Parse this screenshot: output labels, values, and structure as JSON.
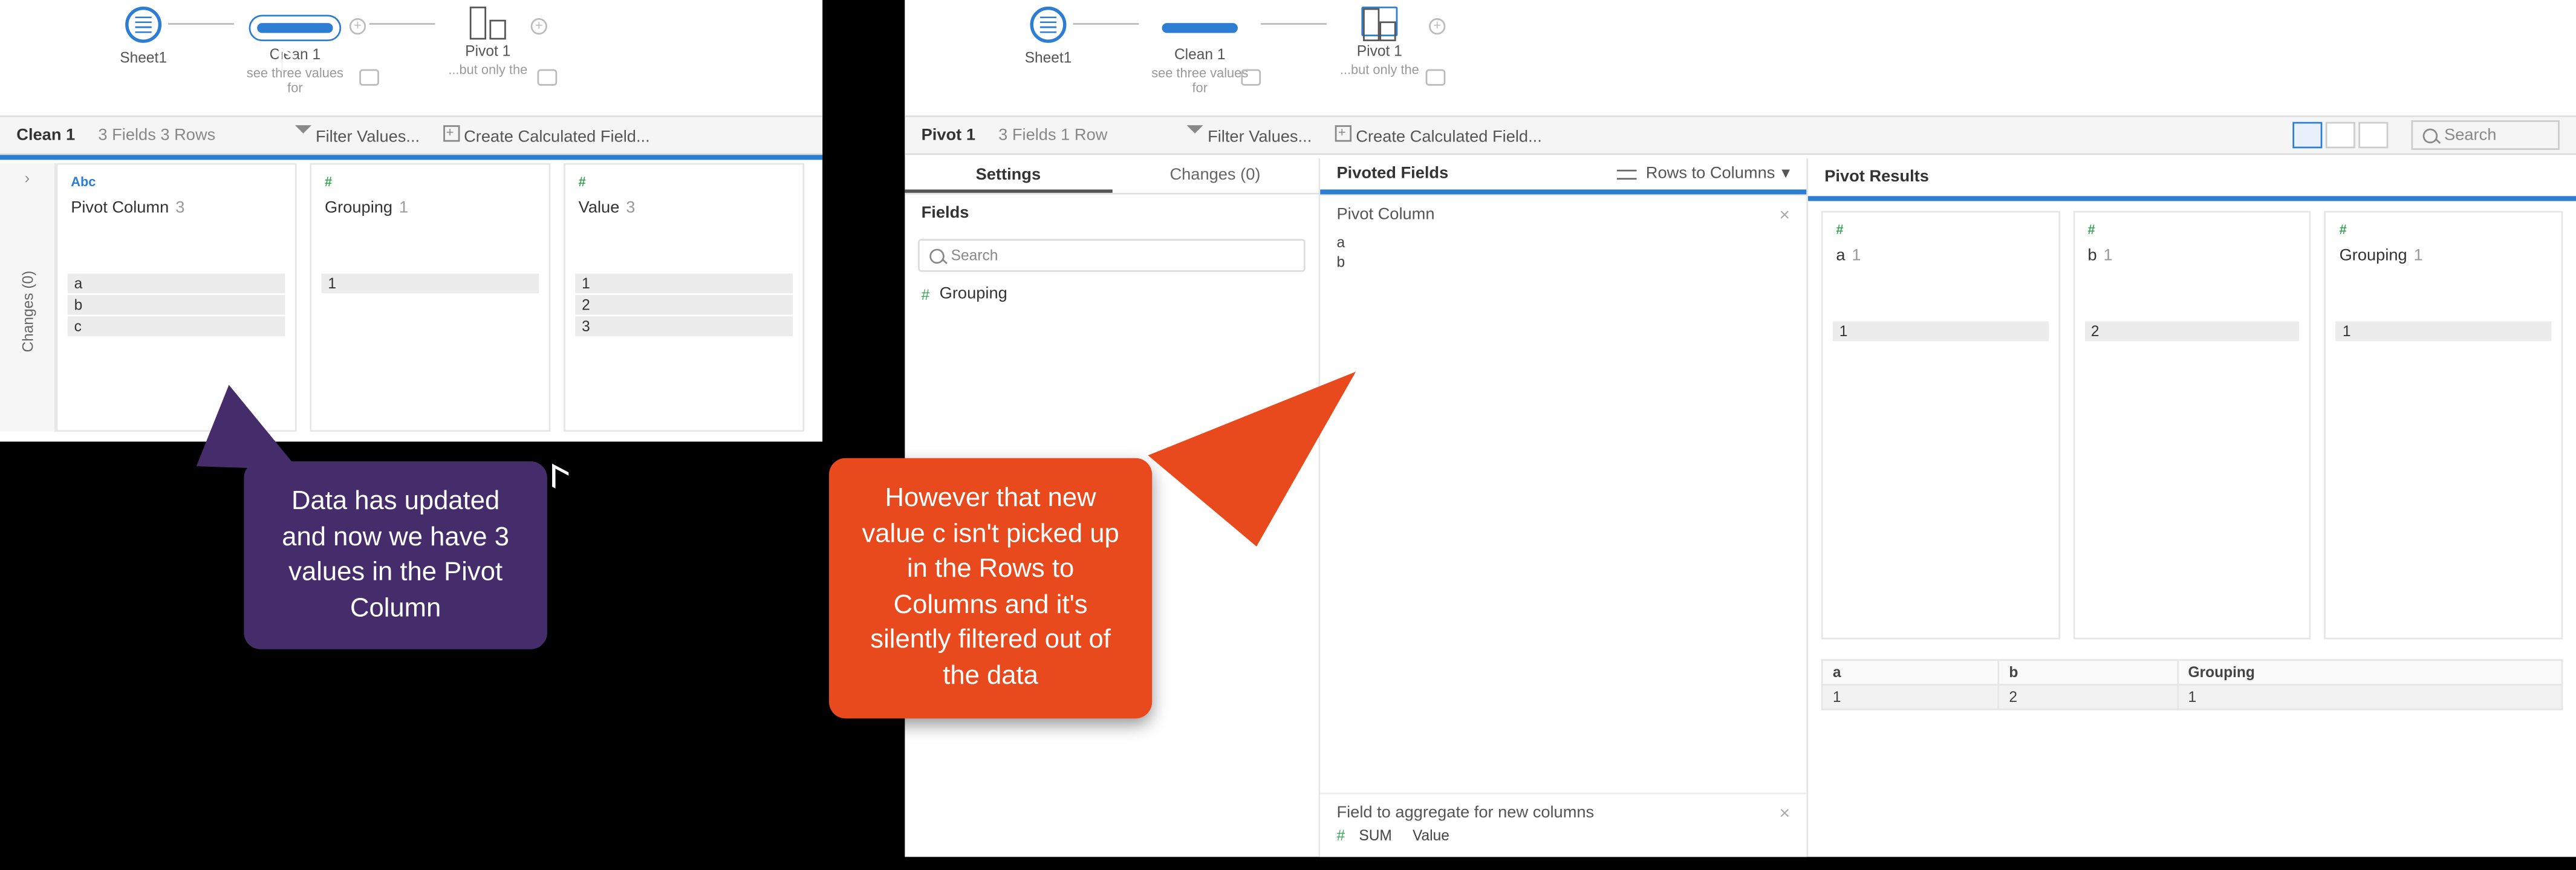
{
  "left": {
    "flow": {
      "nodes": [
        {
          "label": "Sheet1",
          "subtitle": ""
        },
        {
          "label": "Clean 1",
          "subtitle": "see three values for"
        },
        {
          "label": "Pivot 1",
          "subtitle": "...but only the"
        }
      ]
    },
    "info": {
      "step": "Clean 1",
      "meta": "3 Fields   3 Rows",
      "filter": "Filter Values...",
      "calc": "Create Calculated Field..."
    },
    "changes_label": "Changes (0)",
    "expand_glyph": "›",
    "type_abc": "Abc",
    "type_num": "#",
    "cards": [
      {
        "type": "abc",
        "title": "Pivot Column",
        "count": "3",
        "values": [
          "a",
          "b",
          "c"
        ]
      },
      {
        "type": "num",
        "title": "Grouping",
        "count": "1",
        "values": [
          "1"
        ]
      },
      {
        "type": "num",
        "title": "Value",
        "count": "3",
        "values": [
          "1",
          "2",
          "3"
        ]
      }
    ],
    "callout": "Data has updated and now we have 3 values in the Pivot Column"
  },
  "right": {
    "flow": {
      "nodes": [
        {
          "label": "Sheet1",
          "subtitle": ""
        },
        {
          "label": "Clean 1",
          "subtitle": "see three values for"
        },
        {
          "label": "Pivot 1",
          "subtitle": "...but only the"
        }
      ]
    },
    "info": {
      "step": "Pivot 1",
      "meta": "3 Fields   1 Row",
      "filter": "Filter Values...",
      "calc": "Create Calculated Field...",
      "search": "Search"
    },
    "tabs": {
      "settings": "Settings",
      "changes": "Changes (0)"
    },
    "fields": {
      "header": "Fields",
      "search": "Search",
      "items": [
        {
          "type": "#",
          "name": "Grouping"
        }
      ]
    },
    "pivoted": {
      "header": "Pivoted Fields",
      "mode": "Rows to Columns",
      "col_title": "Pivot Column",
      "col_values": [
        "a",
        "b"
      ],
      "agg_title": "Field to aggregate for new columns",
      "agg": {
        "type": "#",
        "func": "SUM",
        "name": "Value"
      }
    },
    "results": {
      "header": "Pivot Results",
      "cards": [
        {
          "type": "num",
          "title": "a",
          "count": "1",
          "values": [
            "1"
          ]
        },
        {
          "type": "num",
          "title": "b",
          "count": "1",
          "values": [
            "2"
          ]
        },
        {
          "type": "num",
          "title": "Grouping",
          "count": "1",
          "values": [
            "1"
          ]
        }
      ],
      "table": {
        "headers": [
          "a",
          "b",
          "Grouping"
        ],
        "row": [
          "1",
          "2",
          "1"
        ]
      }
    },
    "callout": "However that new value c isn't picked up in the Rows to Columns and it's silently filtered out of the data"
  }
}
